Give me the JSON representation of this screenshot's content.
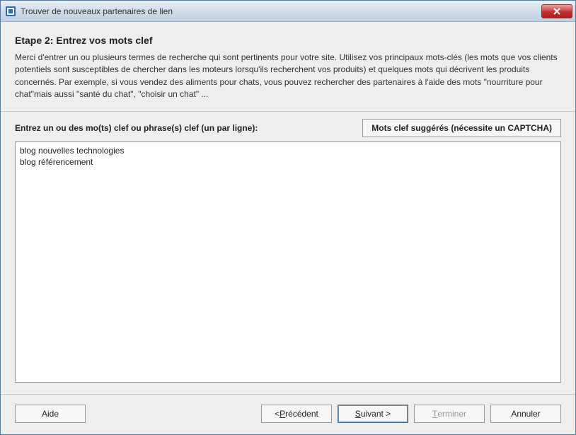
{
  "titlebar": {
    "title": "Trouver de nouveaux partenaires de lien",
    "icon_name": "link-partners-icon"
  },
  "header": {
    "step_title": "Etape 2: Entrez vos mots clef",
    "description": "Merci d'entrer un ou plusieurs termes de recherche qui sont pertinents pour votre site. Utilisez vos principaux mots-clés (les mots que vos clients potentiels sont susceptibles de chercher dans les moteurs lorsqu'ils recherchent vos produits) et quelques mots qui décrivent les produits concernés. Par exemple, si vous vendez des aliments pour chats, vous pouvez rechercher des partenaires à l'aide des mots \"nourriture pour chat\"mais aussi \"santé du chat\", \"choisir un chat\" ..."
  },
  "body": {
    "field_label": "Entrez un ou des mo(ts) clef ou phrase(s) clef (un par ligne):",
    "suggest_button": "Mots clef suggérés (nécessite un CAPTCHA)",
    "textarea_value": "blog nouvelles technologies\nblog référencement"
  },
  "footer": {
    "help_label": "Aide",
    "back_prefix": "< ",
    "back_mnemonic": "P",
    "back_suffix": "récédent",
    "next_prefix": "",
    "next_mnemonic": "S",
    "next_suffix": "uivant >",
    "finish_prefix": "",
    "finish_mnemonic": "T",
    "finish_suffix": "erminer",
    "cancel_label": "Annuler"
  }
}
